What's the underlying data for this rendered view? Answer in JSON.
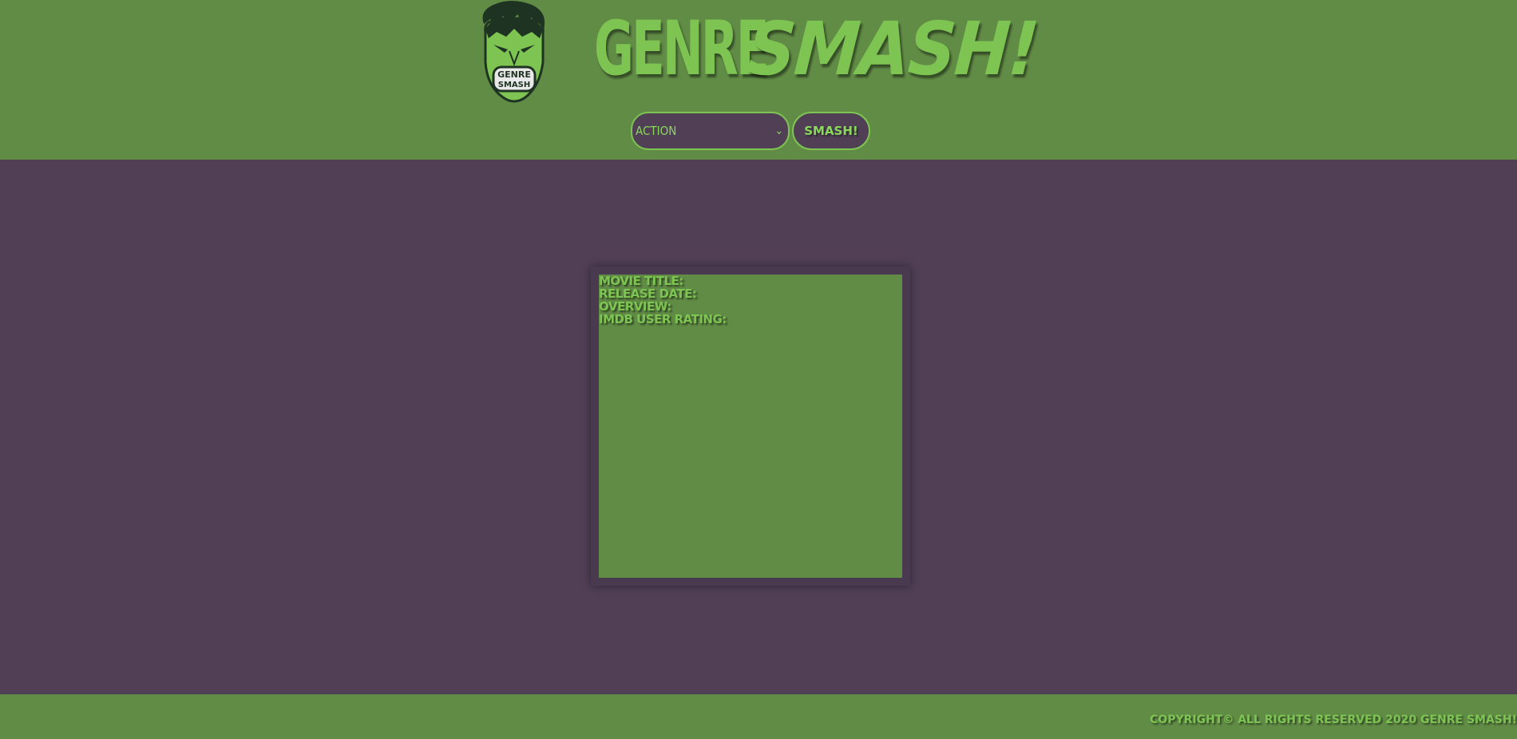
{
  "header": {
    "logo_alt": "Genre Smash",
    "title_part1": "GENRE",
    "title_part2": "SMASH!"
  },
  "controls": {
    "genre_selected": "ACTION",
    "smash_label": "SMASH!"
  },
  "movie_card": {
    "title_label": "MOVIE TITLE:",
    "release_label": "RELEASE DATE:",
    "overview_label": "OVERVIEW:",
    "rating_label": "IMDB USER RATING:"
  },
  "footer": {
    "copyright": "COPYRIGHT© ALL RIGHTS RESERVED 2020 GENRE SMASH!"
  },
  "colors": {
    "header_green": "#618c46",
    "accent_green": "#7ec453",
    "purple": "#503f55"
  }
}
